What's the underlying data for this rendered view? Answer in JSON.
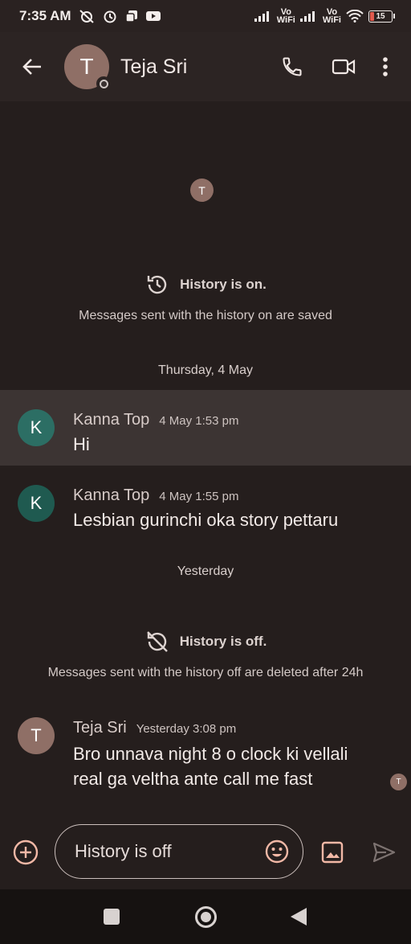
{
  "status_bar": {
    "time": "7:35 AM",
    "vowifi_top": "Vo",
    "vowifi_bottom": "WiFi",
    "battery": "15"
  },
  "header": {
    "avatar_initial": "T",
    "contact_name": "Teja Sri"
  },
  "chat": {
    "top_avatar_initial": "T",
    "history_on": {
      "title": "History is on.",
      "subtitle": "Messages sent with the history on are saved"
    },
    "date_1": "Thursday, 4 May",
    "messages": [
      {
        "initial": "K",
        "sender": "Kanna Top",
        "time": "4 May 1:53 pm",
        "text": "Hi"
      },
      {
        "initial": "K",
        "sender": "Kanna Top",
        "time": "4 May 1:55 pm",
        "text": "Lesbian gurinchi oka story pettaru"
      },
      {
        "initial": "T",
        "sender": "Teja Sri",
        "time": "Yesterday 3:08 pm",
        "text": "Bro unnava night 8 o clock ki vellali real ga veltha ante call me fast"
      }
    ],
    "date_2": "Yesterday",
    "history_off": {
      "title": "History is off.",
      "subtitle": "Messages sent with the history off are deleted after 24h"
    },
    "read_receipt_initial": "T"
  },
  "composer": {
    "placeholder": "History is off"
  },
  "colors": {
    "background": "#251e1d",
    "accent": "#f2b8a6",
    "avatar_k_1": "#2c6e64",
    "avatar_k_2": "#1f5a50",
    "avatar_t": "#8f6f66"
  }
}
